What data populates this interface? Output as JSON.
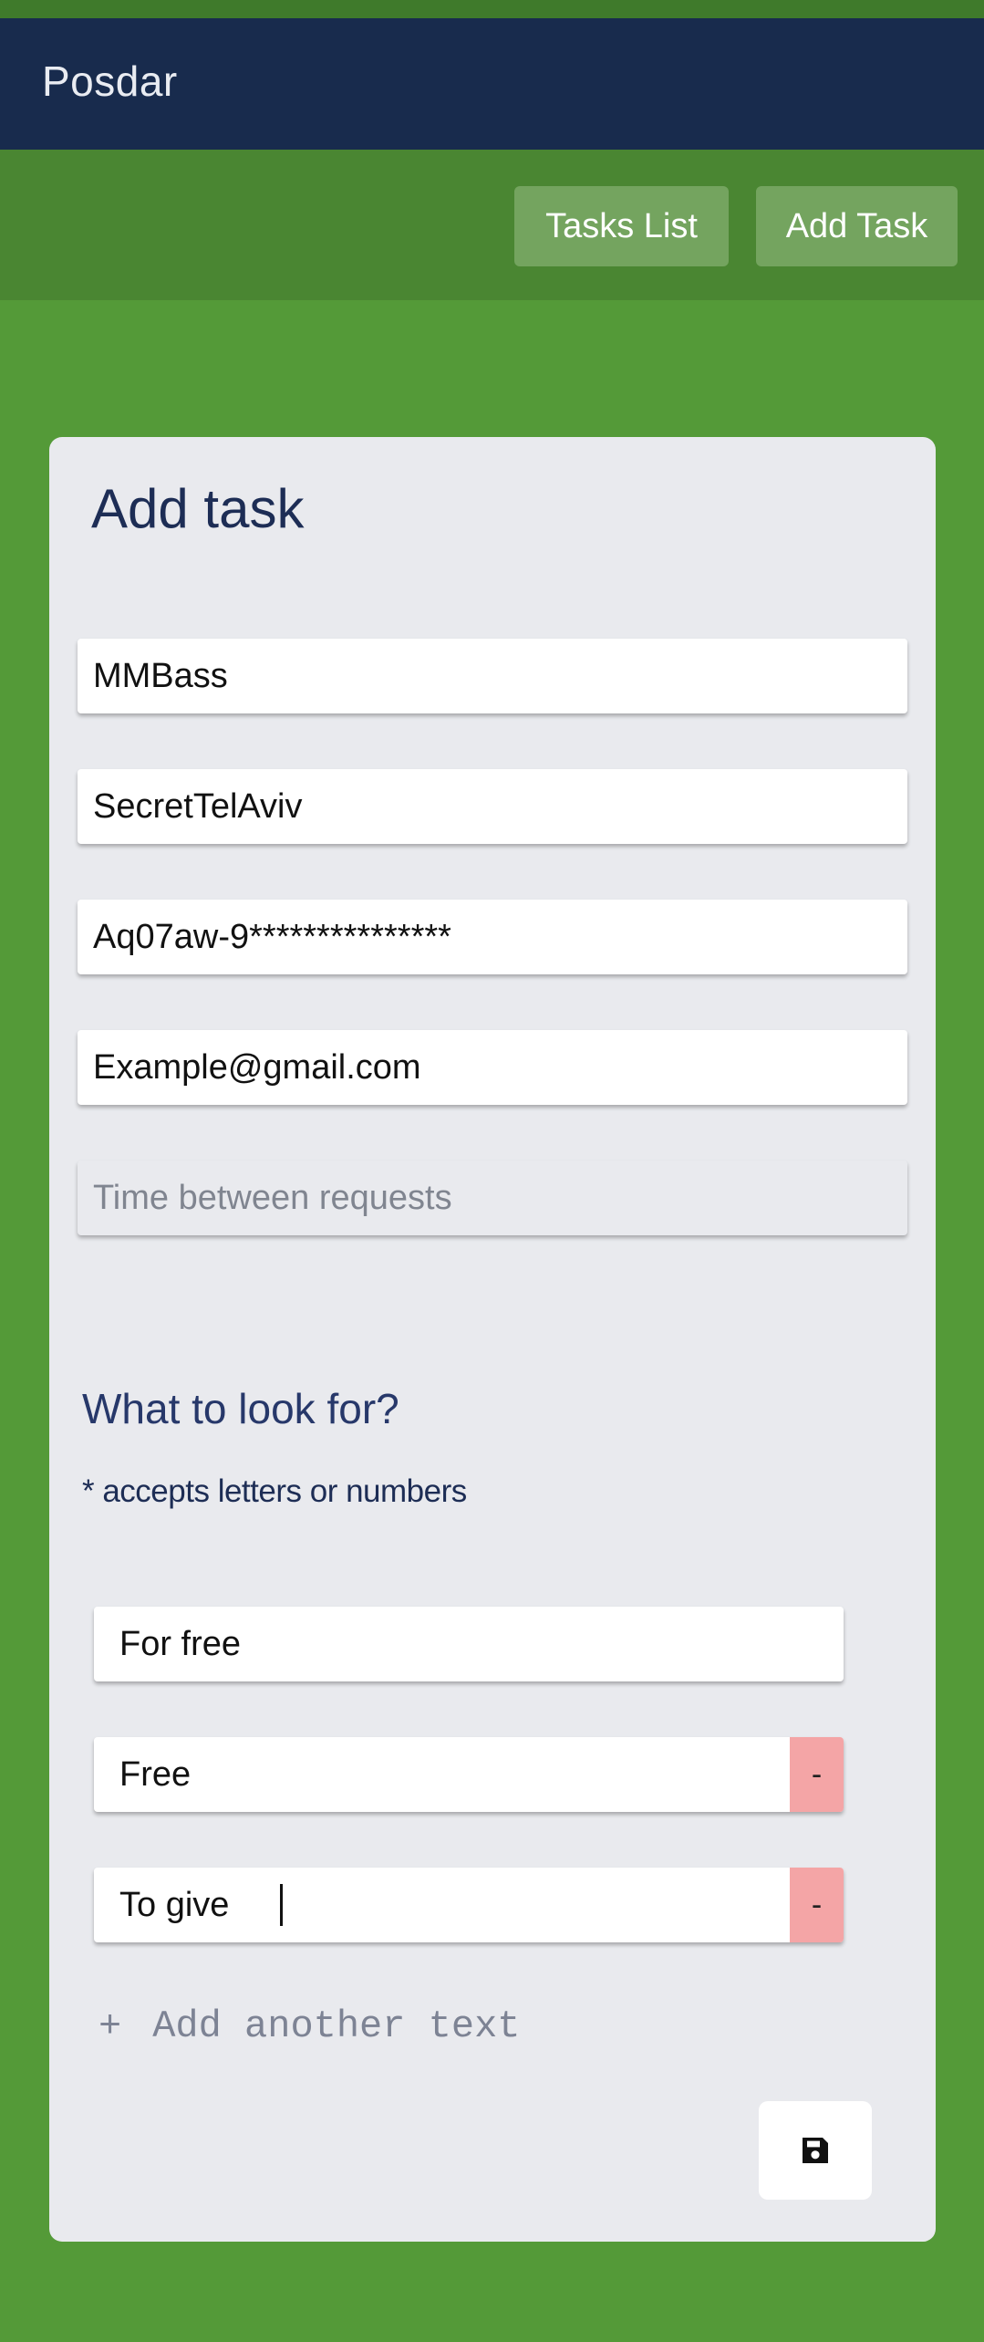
{
  "app": {
    "title": "Posdar"
  },
  "toolbar": {
    "tasks_list_label": "Tasks List",
    "add_task_label": "Add Task"
  },
  "form": {
    "title": "Add task",
    "fields": [
      {
        "value": "MMBass",
        "placeholder": ""
      },
      {
        "value": "SecretTelAviv",
        "placeholder": ""
      },
      {
        "value": "Aq07aw-9***************",
        "placeholder": ""
      },
      {
        "value": "Example@gmail.com",
        "placeholder": ""
      },
      {
        "value": "",
        "placeholder": "Time between requests"
      }
    ],
    "search_section": {
      "title": "What to look for?",
      "hint": "* accepts letters or numbers",
      "terms": [
        {
          "value": "For free",
          "removable": false
        },
        {
          "value": "Free",
          "removable": true
        },
        {
          "value": "To give",
          "removable": true
        }
      ],
      "remove_label": "-",
      "add_plus": "+",
      "add_label": "Add another text"
    },
    "save_icon": "floppy-disk-icon"
  },
  "colors": {
    "background": "#549a38",
    "navbar": "#182b4d",
    "toolbar": "#4a8632",
    "toolbar_button": "#74a45f",
    "card": "#e9eaee",
    "remove_button": "#f4a5a6",
    "title_text": "#1d2d55"
  }
}
